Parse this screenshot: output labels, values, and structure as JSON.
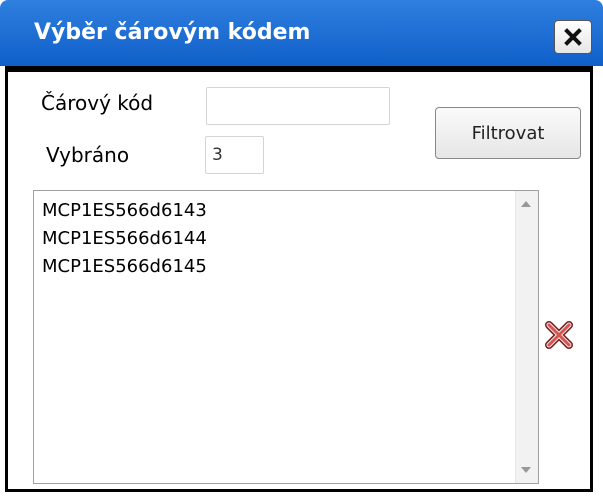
{
  "dialog": {
    "title": "Výběr čárovým kódem",
    "close_icon": "close-icon"
  },
  "form": {
    "barcode_label": "Čárový kód",
    "barcode_value": "",
    "selected_label": "Vybráno",
    "selected_value": "3",
    "filter_button_label": "Filtrovat"
  },
  "list": {
    "items": [
      "MCP1ES566d6143",
      "MCP1ES566d6144",
      "MCP1ES566d6145"
    ]
  },
  "icons": {
    "delete": "delete-icon",
    "scroll_up": "chevron-up-icon",
    "scroll_down": "chevron-down-icon"
  },
  "colors": {
    "titlebar": "#1a6ad4",
    "delete_icon": "#c0392b"
  }
}
